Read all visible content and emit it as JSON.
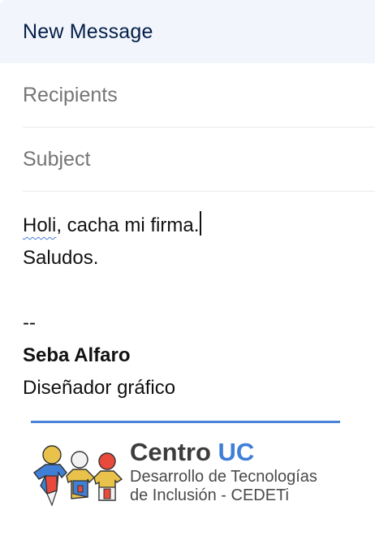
{
  "compose": {
    "title": "New Message",
    "recipients_placeholder": "Recipients",
    "subject_placeholder": "Subject",
    "body": {
      "line1_word1": "Holi",
      "line1_rest": ", cacha mi firma.",
      "line2": "Saludos."
    },
    "signature": {
      "separator": "--",
      "name": "Seba Alfaro",
      "role": "Diseñador gráfico",
      "divider_color": "#4a84d9",
      "logo": {
        "title_main": "Centro",
        "title_accent": "UC",
        "subtitle_line1": "Desarrollo de Tecnologías",
        "subtitle_line2": "de Inclusión - CEDETi",
        "accent_color": "#3f7fd6",
        "icon": "people-figures-icon"
      }
    }
  },
  "colors": {
    "header_bg": "#f2f6fc",
    "header_text": "#041e49",
    "placeholder": "#757575",
    "field_divider": "#e8eaed",
    "spellcheck_underline": "#4a7dd9"
  }
}
